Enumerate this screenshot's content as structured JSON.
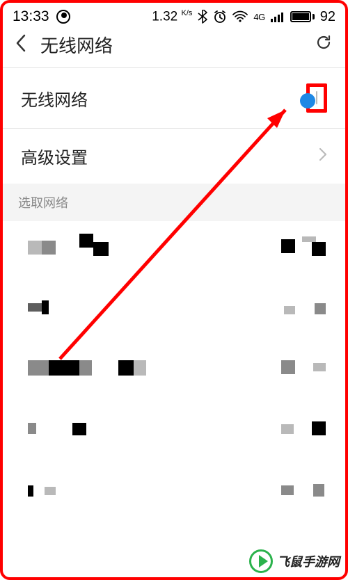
{
  "status": {
    "time": "13:33",
    "speed_value": "1.32",
    "speed_unit": "K/s",
    "network_label": "4G",
    "battery_pct": "92"
  },
  "header": {
    "title": "无线网络"
  },
  "rows": {
    "wifi_label": "无线网络",
    "advanced_label": "高级设置"
  },
  "section": {
    "choose_network": "选取网络"
  },
  "watermark": {
    "text": "飞鼠手游网"
  }
}
